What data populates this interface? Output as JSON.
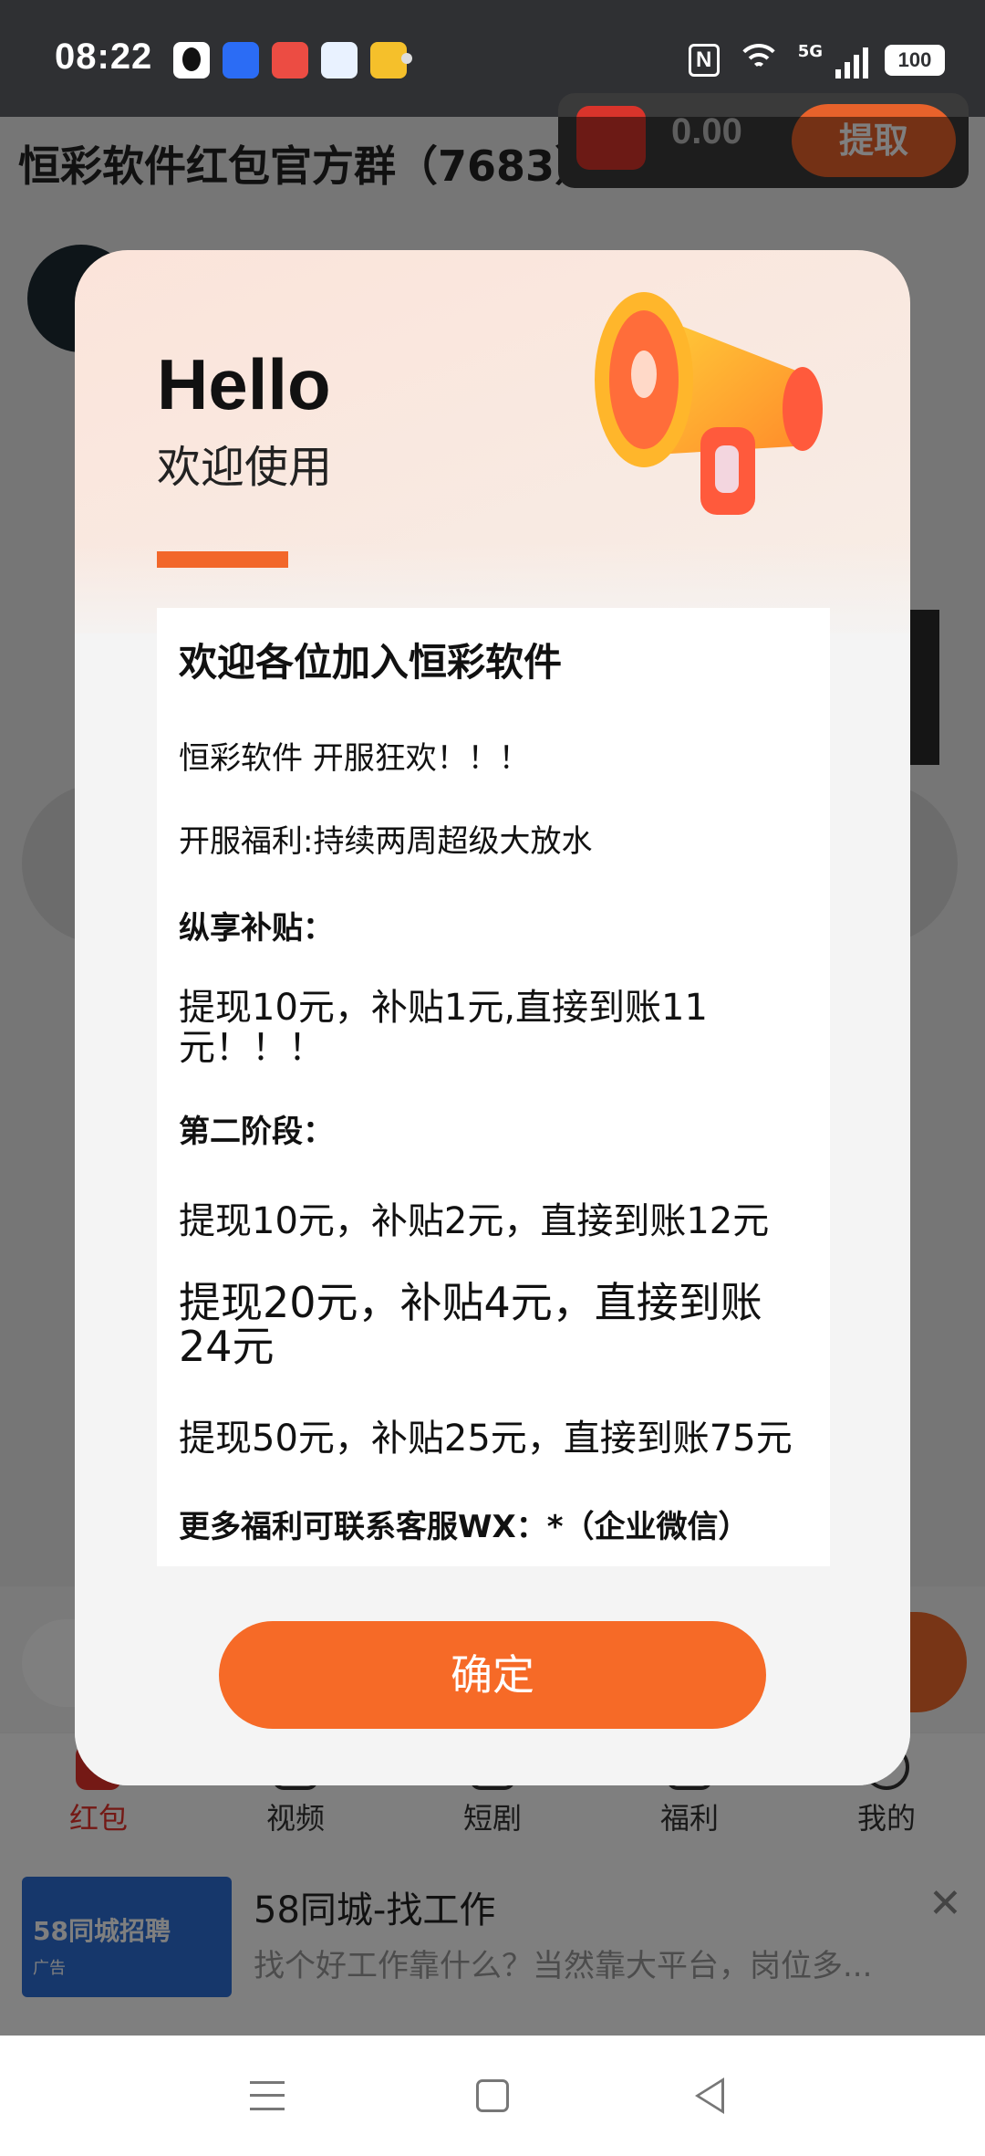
{
  "status_bar": {
    "time": "08:22",
    "app_icons": [
      "qq-icon",
      "app-icon",
      "video-icon",
      "browser-icon",
      "weibo-icon"
    ],
    "nfc": "N",
    "network": "5G",
    "battery": "100"
  },
  "background": {
    "group_title": "恒彩软件红包官方群（7683）",
    "wallet_amount": "0.00",
    "withdraw_label": "提取",
    "tabs": [
      {
        "label": "红包",
        "icon": "red-packet-icon",
        "active": true
      },
      {
        "label": "视频",
        "icon": "video-icon"
      },
      {
        "label": "短剧",
        "icon": "drama-icon"
      },
      {
        "label": "福利",
        "icon": "gift-icon"
      },
      {
        "label": "我的",
        "icon": "person-icon"
      }
    ],
    "ad": {
      "thumb_title": "58同城招聘",
      "thumb_tag": "广告",
      "title": "58同城-找工作",
      "description": "找个好工作靠什么？当然靠大平台，岗位多..."
    }
  },
  "dialog": {
    "hello": "Hello",
    "welcome": "欢迎使用",
    "content": {
      "title": "欢迎各位加入恒彩软件",
      "line1": "恒彩软件 开服狂欢！！！",
      "line2": "开服福利:持续两周超级大放水",
      "line3": "纵享补贴：",
      "line4": "提现10元，补贴1元,直接到账11元！！！",
      "line5": "第二阶段：",
      "line6": "提现10元，补贴2元，直接到账12元",
      "line7": "提现20元，补贴4元，直接到账24元",
      "line8": "提现50元，补贴25元，直接到账75元",
      "line9": "更多福利可联系客服WX：*（企业微信）"
    },
    "confirm_label": "确定"
  },
  "colors": {
    "accent": "#f66a27",
    "status_bar": "#2f3033"
  }
}
